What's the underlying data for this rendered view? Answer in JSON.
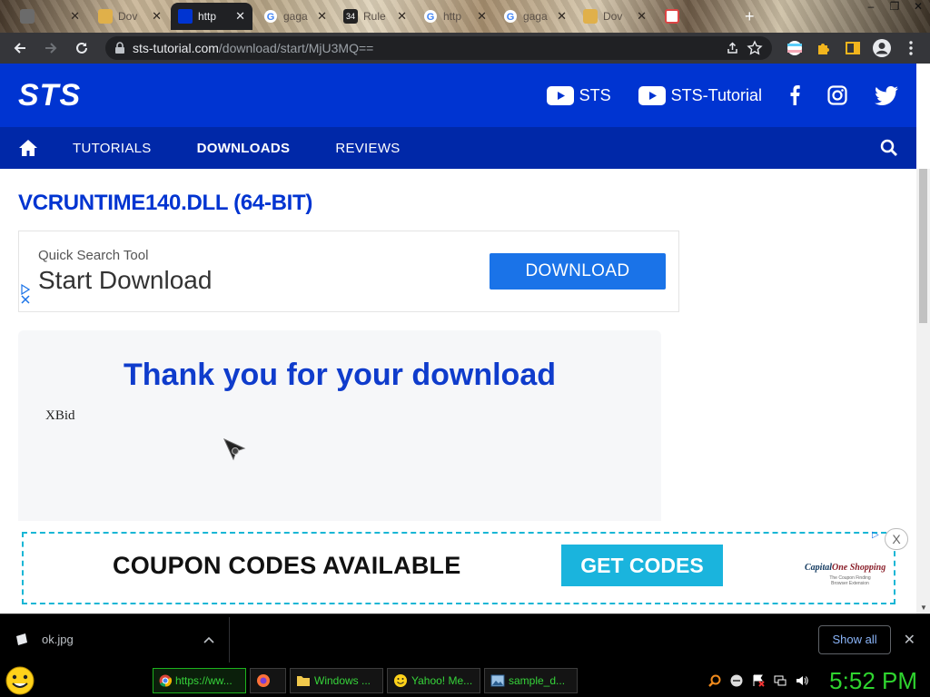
{
  "tabs": [
    {
      "label": "",
      "color": "#7a7a7a"
    },
    {
      "label": "Dov",
      "color": "#e0b04a"
    },
    {
      "label": "http",
      "color": "#0034d1"
    },
    {
      "label": "gaga",
      "color": "#4285f4"
    },
    {
      "label": "Rule",
      "color": "#222"
    },
    {
      "label": "http",
      "color": "#4285f4"
    },
    {
      "label": "gaga",
      "color": "#4285f4"
    },
    {
      "label": "Dov",
      "color": "#e0b04a"
    }
  ],
  "browser": {
    "url_domain": "sts-tutorial.com",
    "url_path": "/download/start/MjU3MQ=="
  },
  "site": {
    "logo": "STS",
    "channels": [
      "STS",
      "STS-Tutorial"
    ],
    "nav": [
      "TUTORIALS",
      "DOWNLOADS",
      "REVIEWS"
    ],
    "active_nav": "DOWNLOADS"
  },
  "page": {
    "title": "VCRUNTIME140.DLL (64-BIT)",
    "ad": {
      "small": "Quick Search Tool",
      "big": "Start Download",
      "button": "DOWNLOAD"
    },
    "thanks": "Thank you for your download",
    "xbid": "XBid"
  },
  "coupon": {
    "label": "COUPON CODES AVAILABLE",
    "button": "GET CODES",
    "close": "X",
    "brand_a": "Capital",
    "brand_b": "One Shopping",
    "brand_tag": "The Coupon Finding Browser Extension"
  },
  "download": {
    "file": "ok.jpg",
    "show_all": "Show all"
  },
  "taskbar": {
    "items": [
      "https://ww...",
      "",
      "Windows ...",
      "Yahoo! Me...",
      "sample_d..."
    ],
    "clock": "5:52 PM"
  },
  "colors": {
    "brand_blue": "#0034d1",
    "nav_blue": "#0028a8",
    "coupon_cyan": "#1ab4dd",
    "clock_green": "#2fd42f"
  }
}
